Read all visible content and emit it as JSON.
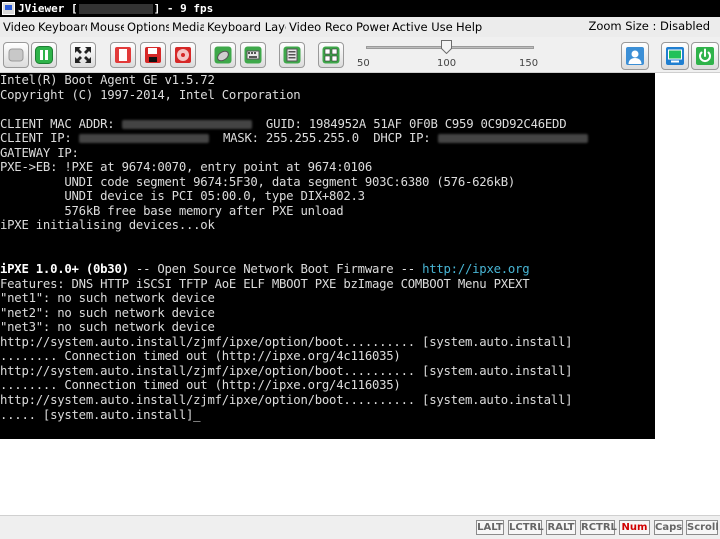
{
  "window": {
    "title_prefix": "JViewer [",
    "title_suffix": "] - 9 fps"
  },
  "menu": {
    "items": [
      "Video",
      "Keyboard",
      "Mouse",
      "Options",
      "Media",
      "Keyboard Layo",
      "Video Recor",
      "Power",
      "Active User",
      "Help"
    ],
    "zoom_status": "Zoom Size : Disabled"
  },
  "toolbar": {
    "icons": [
      "stop-icon",
      "pause-icon",
      "fullscreen-icon",
      "document-icon",
      "floppy-icon",
      "cdrom-icon",
      "mouse-icon",
      "keyboard-icon",
      "hotkey-icon",
      "multi-window-icon",
      "user-icon",
      "monitor-icon",
      "power-icon"
    ]
  },
  "zoom_slider": {
    "ticks": [
      "50",
      "100",
      "150"
    ],
    "value": 100
  },
  "console": {
    "l1": "Intel(R) Boot Agent GE v1.5.72",
    "l2": "Copyright (C) 1997-2014, Intel Corporation",
    "l3": "",
    "l4a": "CLIENT MAC ADDR: ",
    "l4b": "  GUID: 1984952A 51AF 0F0B C959 0C9D92C46EDD",
    "l5a": "CLIENT IP: ",
    "l5b": "  MASK: 255.255.255.0  DHCP IP: ",
    "l6": "GATEWAY IP:",
    "l7": "PXE->EB: !PXE at 9674:0070, entry point at 9674:0106",
    "l8": "         UNDI code segment 9674:5F30, data segment 903C:6380 (576-626kB)",
    "l9": "         UNDI device is PCI 05:00.0, type DIX+802.3",
    "l10": "         576kB free base memory after PXE unload",
    "l11": "iPXE initialising devices...ok",
    "l12a": "iPXE 1.0.0+ (0b30)",
    "l12b": " -- Open Source Network Boot Firmware -- ",
    "l12c": "http://ipxe.org",
    "l13": "Features: DNS HTTP iSCSI TFTP AoE ELF MBOOT PXE bzImage COMBOOT Menu PXEXT",
    "l14": "\"net1\": no such network device",
    "l15": "\"net2\": no such network device",
    "l16": "\"net3\": no such network device",
    "l17": "http://system.auto.install/zjmf/ipxe/option/boot.......... [system.auto.install]",
    "l18": "........ Connection timed out (http://ipxe.org/4c116035)",
    "l19": "http://system.auto.install/zjmf/ipxe/option/boot.......... [system.auto.install]",
    "l20": "........ Connection timed out (http://ipxe.org/4c116035)",
    "l21": "http://system.auto.install/zjmf/ipxe/option/boot.......... [system.auto.install]",
    "l22": "..... [system.auto.install]",
    "cursor": "_"
  },
  "status_keys": [
    "LALT",
    "LCTRL",
    "RALT",
    "RCTRL",
    "Num",
    "Caps",
    "Scroll"
  ],
  "colors": {
    "console_bg": "#000000",
    "console_text": "#dcdcdc",
    "link": "#48b5d4",
    "num_lock_active": "#d00000"
  }
}
